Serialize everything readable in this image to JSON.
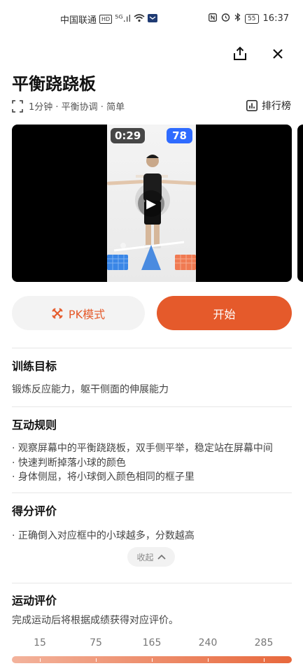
{
  "status_bar": {
    "carrier": "中国联通",
    "hd": "HD",
    "signal": "⁵ᴳ.ıl",
    "battery": "55",
    "time": "16:37"
  },
  "header": {
    "share_icon": "share-icon",
    "close_icon": "close-icon"
  },
  "exercise": {
    "title": "平衡跷跷板",
    "meta": "1分钟 · 平衡协调 · 简单",
    "leaderboard_label": "排行榜"
  },
  "video": {
    "timer": "0:29",
    "score": "78"
  },
  "actions": {
    "pk_label": "PK模式",
    "start_label": "开始"
  },
  "sections": {
    "goal": {
      "title": "训练目标",
      "text": "锻炼反应能力，躯干侧面的伸展能力"
    },
    "rules": {
      "title": "互动规则",
      "items": [
        "· 观察屏幕中的平衡跷跷板，双手侧平举，稳定站在屏幕中间",
        "· 快速判断掉落小球的颜色",
        "· 身体侧屈，将小球倒入颜色相同的框子里"
      ]
    },
    "scoring": {
      "title": "得分评价",
      "items": [
        "· 正确倒入对应框中的小球越多，分数越高"
      ]
    },
    "collapse_label": "收起",
    "evaluation": {
      "title": "运动评价",
      "text": "完成运动后将根据成绩获得对应评价。",
      "scale": [
        "15",
        "75",
        "165",
        "240",
        "285"
      ]
    }
  },
  "colors": {
    "accent": "#e55a2b",
    "score_badge": "#2f6bff"
  }
}
